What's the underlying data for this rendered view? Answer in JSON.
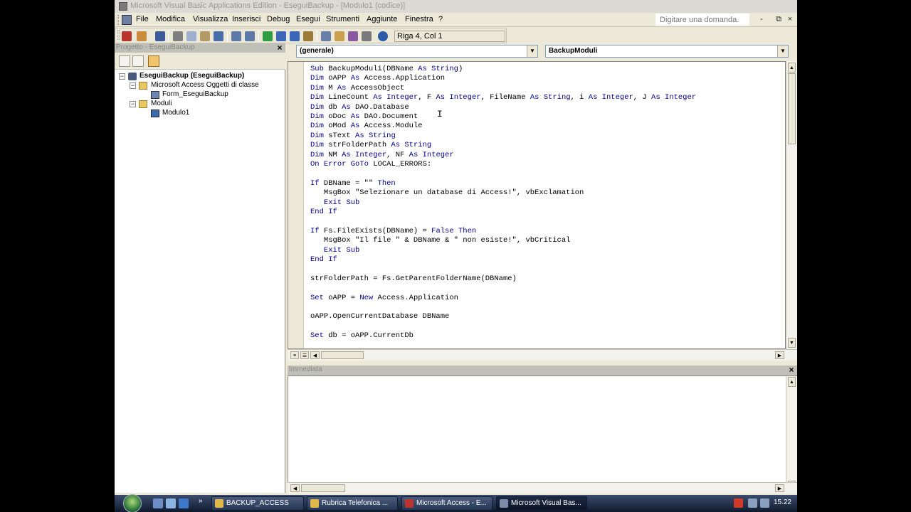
{
  "window": {
    "title": "Microsoft Visual Basic Applications Edition - EseguiBackup - [Modulo1 (codice)]"
  },
  "menu": {
    "items": [
      "File",
      "Modifica",
      "Visualizza",
      "Inserisci",
      "Debug",
      "Esegui",
      "Strumenti",
      "Aggiunte",
      "Finestra",
      "?"
    ],
    "help_box_text": "Digitare una domanda.",
    "mdi_buttons": [
      "-",
      "⧉",
      "×"
    ]
  },
  "toolbar": {
    "position_status": "Riga 4, Col 1"
  },
  "project_panel": {
    "caption": "Progetto - EseguiBackup",
    "close": "×",
    "tree": [
      {
        "label": "EseguiBackup (EseguiBackup)",
        "bold": true
      },
      {
        "label": "Microsoft Access Oggetti di classe"
      },
      {
        "label": "Form_EseguiBackup"
      },
      {
        "label": "Moduli"
      },
      {
        "label": "Modulo1"
      }
    ]
  },
  "code_window": {
    "object_combo": "(generale)",
    "procedure_combo": "BackupModuli",
    "lines": [
      "Sub BackupModuli(DBName As String)",
      "Dim oAPP As Access.Application",
      "Dim M As AccessObject",
      "Dim LineCount As Integer, F As Integer, FileName As String, i As Integer, J As Integer",
      "Dim db As DAO.Database",
      "Dim oDoc As DAO.Document",
      "Dim oMod As Access.Module",
      "Dim sText As String",
      "Dim strFolderPath As String",
      "Dim NM As Integer, NF As Integer",
      "On Error GoTo LOCAL_ERRORS:",
      "",
      "If DBName = \"\" Then",
      "   MsgBox \"Selezionare un database di Access!\", vbExclamation",
      "   Exit Sub",
      "End If",
      "",
      "If Fs.FileExists(DBName) = False Then",
      "   MsgBox \"Il file \" & DBName & \" non esiste!\", vbCritical",
      "   Exit Sub",
      "End If",
      "",
      "strFolderPath = Fs.GetParentFolderName(DBName)",
      "",
      "Set oAPP = New Access.Application",
      "",
      "oAPP.OpenCurrentDatabase DBName",
      "",
      "Set db = oAPP.CurrentDb"
    ]
  },
  "immediate": {
    "caption": "Immediata",
    "close": "×"
  },
  "taskbar": {
    "buttons": [
      {
        "label": "BACKUP_ACCESS"
      },
      {
        "label": "Rubrica Telefonica ..."
      },
      {
        "label": "Microsoft Access - E..."
      },
      {
        "label": "Microsoft Visual Bas..."
      }
    ],
    "clock": "15.22"
  }
}
